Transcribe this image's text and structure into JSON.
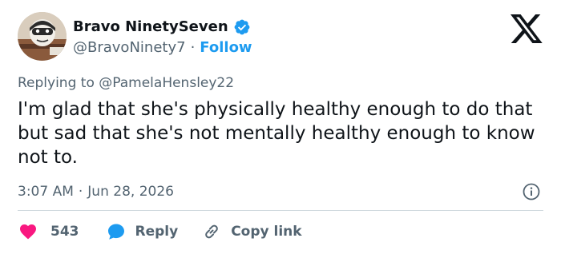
{
  "user": {
    "display_name": "Bravo NinetySeven",
    "handle": "@BravoNinety7",
    "separator": "·",
    "follow_label": "Follow"
  },
  "brand": {
    "logo_icon": "x-logo-icon"
  },
  "reply_context": {
    "prefix": "Replying to",
    "handle": "@PamelaHensley22"
  },
  "tweet": {
    "text": "I'm glad that she's physically healthy enough to do that but sad that she's not mentally healthy enough to know not to."
  },
  "meta": {
    "time": "3:07 AM",
    "separator": "·",
    "date": "Jun 28, 2026"
  },
  "actions": {
    "like_count": "543",
    "reply_label": "Reply",
    "copy_link_label": "Copy link"
  },
  "colors": {
    "accent": "#1d9bf0",
    "like": "#f91880",
    "text": "#0f1419",
    "muted": "#536471",
    "divider": "#cfd9de"
  }
}
